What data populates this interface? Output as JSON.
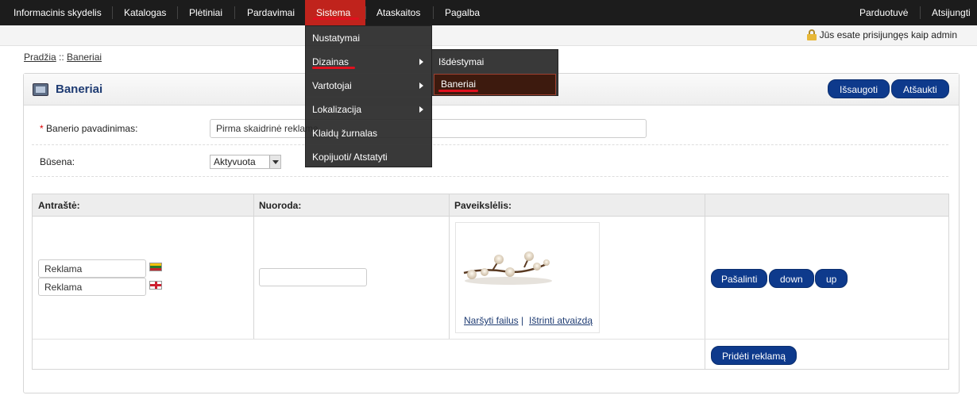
{
  "nav": {
    "items": [
      {
        "label": "Informacinis skydelis"
      },
      {
        "label": "Katalogas"
      },
      {
        "label": "Plėtiniai"
      },
      {
        "label": "Pardavimai"
      },
      {
        "label": "Sistema"
      },
      {
        "label": "Ataskaitos"
      },
      {
        "label": "Pagalba"
      }
    ],
    "right": [
      {
        "label": "Parduotuvė"
      },
      {
        "label": "Atsijungti"
      }
    ]
  },
  "login_info": "Jūs esate prisijungęs kaip admin",
  "breadcrumb": {
    "home": "Pradžia",
    "sep": " :: ",
    "current": "Baneriai"
  },
  "panel": {
    "title": "Baneriai",
    "save_label": "Išsaugoti",
    "cancel_label": "Atšaukti"
  },
  "form": {
    "name_label": "Banerio pavadinimas:",
    "name_required": "*",
    "name_value": "Pirma skaidrinė reklama",
    "status_label": "Būsena:",
    "status_value": "Aktyvuota"
  },
  "table": {
    "headers": [
      "Antraštė:",
      "Nuoroda:",
      "Paveikslėlis:",
      ""
    ],
    "titles": [
      "Reklama",
      "Reklama"
    ],
    "link_value": "",
    "browse_label": "Naršyti failus",
    "link_sep": "|",
    "delete_image_label": "Ištrinti atvaizdą",
    "remove_label": "Pašalinti",
    "down_label": "down",
    "up_label": "up",
    "add_label": "Pridėti reklamą"
  },
  "menu_sistema": {
    "items": [
      {
        "label": "Nustatymai"
      },
      {
        "label": "Dizainas"
      },
      {
        "label": "Vartotojai"
      },
      {
        "label": "Lokalizacija"
      },
      {
        "label": "Klaidų žurnalas"
      },
      {
        "label": "Kopijuoti/ Atstatyti"
      }
    ]
  },
  "menu_dizainas": {
    "items": [
      {
        "label": "Išdėstymai"
      },
      {
        "label": "Baneriai"
      }
    ]
  },
  "colors": {
    "accent": "#0e3a8c",
    "nav_bg": "#1c1c1c",
    "active_red": "#c0231c"
  }
}
